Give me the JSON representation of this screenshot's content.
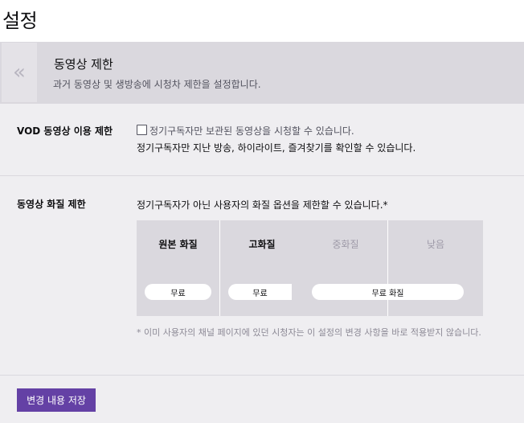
{
  "page": {
    "title": "설정"
  },
  "section": {
    "collapse_glyph": "«",
    "title": "동영상 제한",
    "description": "과거 동영상 및 생방송에 시청차 제한을 설정합니다."
  },
  "vod_restriction": {
    "label": "VOD 동영상 이용 제한",
    "checkbox_label": "정기구독자만 보관된 동영상을 시청할 수 있습니다.",
    "checked": false,
    "note": "정기구독자만 지난 방송, 하이라이트, 즐겨찾기를 확인할 수 있습니다."
  },
  "quality_restriction": {
    "label": "동영상 화질 제한",
    "description": "정기구독자가 아닌 사용자의 화질 옵션을 제한할 수 있습니다.*",
    "columns": [
      {
        "name": "원본 화질",
        "active": true
      },
      {
        "name": "고화질",
        "active": true
      },
      {
        "name": "중화질",
        "active": false
      },
      {
        "name": "낮음",
        "active": false
      }
    ],
    "pills": [
      "무료",
      "무료",
      "무료 화질"
    ],
    "footnote": "* 이미 사용자의 채널 페이지에 있던 시청자는 이 설정의 변경 사항을 바로 적용받지 않습니다."
  },
  "actions": {
    "save_label": "변경 내용 저장"
  },
  "colors": {
    "accent": "#6441a5",
    "panel": "#efeef1",
    "header": "#dad8de"
  }
}
